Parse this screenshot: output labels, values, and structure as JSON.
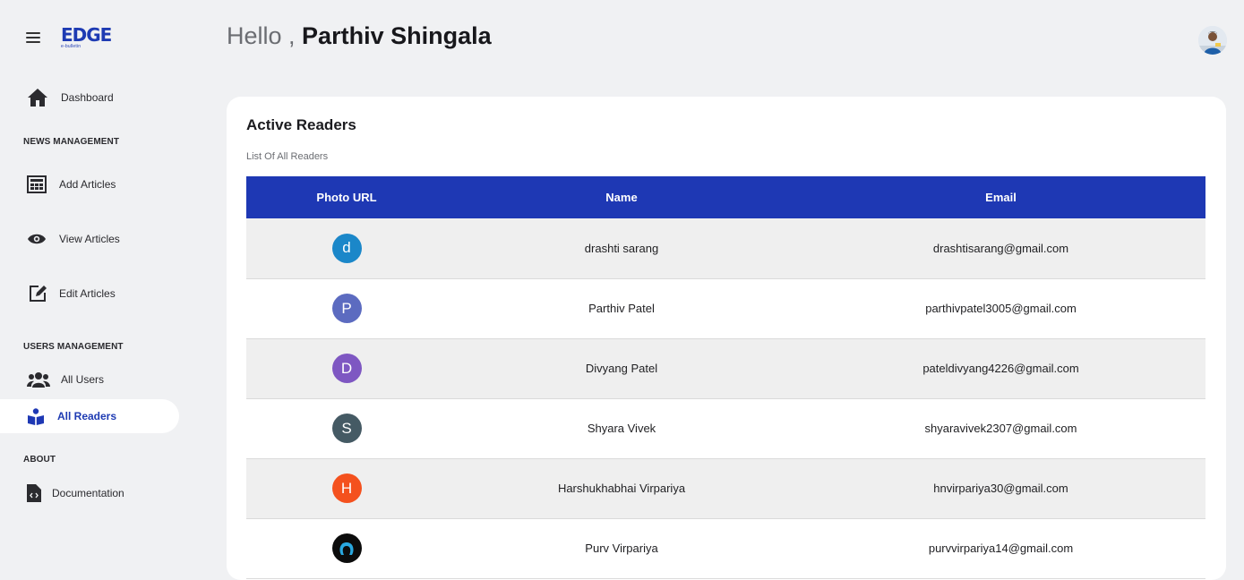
{
  "app": {
    "logo_text": "EDGE",
    "logo_subtext": "e-bulletin"
  },
  "sidebar": {
    "dashboard": "Dashboard",
    "sections": {
      "news": "NEWS MANAGEMENT",
      "users": "USERS MANAGEMENT",
      "about": "ABOUT"
    },
    "items": {
      "add_articles": "Add Articles",
      "view_articles": "View Articles",
      "edit_articles": "Edit Articles",
      "all_users": "All Users",
      "all_readers": "All Readers",
      "documentation": "Documentation"
    }
  },
  "header": {
    "greeting": "Hello ,",
    "user_name": "Parthiv Shingala"
  },
  "card": {
    "title": "Active Readers",
    "subtitle": "List Of All Readers",
    "columns": [
      "Photo URL",
      "Name",
      "Email"
    ],
    "rows": [
      {
        "initial": "d",
        "avatar_color": "#1b87c9",
        "name": "drashti sarang",
        "email": "drashtisarang@gmail.com"
      },
      {
        "initial": "P",
        "avatar_color": "#5c6bc0",
        "name": "Parthiv Patel",
        "email": "parthivpatel3005@gmail.com"
      },
      {
        "initial": "D",
        "avatar_color": "#7e57c2",
        "name": "Divyang Patel",
        "email": "pateldivyang4226@gmail.com"
      },
      {
        "initial": "S",
        "avatar_color": "#455a64",
        "name": "Shyara Vivek",
        "email": "shyaravivek2307@gmail.com"
      },
      {
        "initial": "H",
        "avatar_color": "#f4511e",
        "name": "Harshukhabhai Virpariya",
        "email": "hnvirpariya30@gmail.com"
      },
      {
        "initial": "",
        "avatar_color": "#0c0c0c",
        "name": "Purv Virpariya",
        "email": "purvvirpariya14@gmail.com"
      }
    ]
  },
  "colors": {
    "accent": "#1e38b4",
    "background": "#f0f1f3"
  }
}
